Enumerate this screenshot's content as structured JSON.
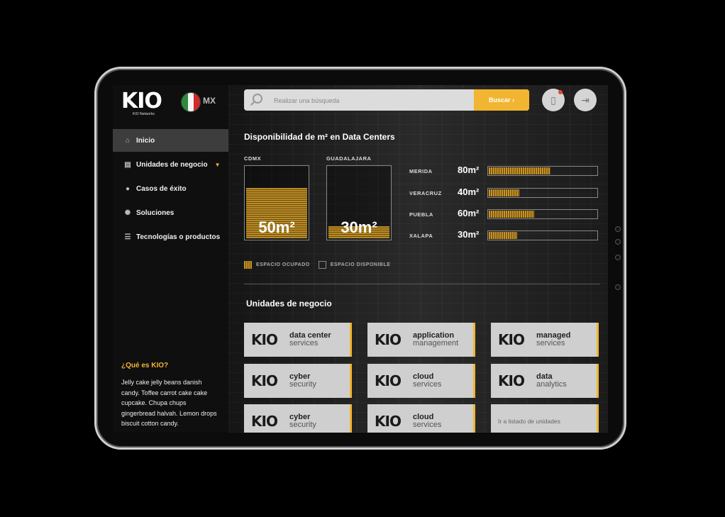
{
  "brand": {
    "logo": "KIO",
    "logo_sub": "KIO Networks",
    "country": "MX"
  },
  "colors": {
    "accent": "#f2b531",
    "sidebar_bg": "#0f0f0f",
    "card_bg": "#cfcfcf"
  },
  "sidebar": {
    "items": [
      {
        "label": "Inicio",
        "icon": "home-icon",
        "active": true
      },
      {
        "label": "Unidades de negocio",
        "icon": "server-icon",
        "has_dropdown": true
      },
      {
        "label": "Casos de éxito",
        "icon": "apple-icon"
      },
      {
        "label": "Soluciones",
        "icon": "lightbulb-icon"
      },
      {
        "label": "Tecnologías o productos",
        "icon": "list-icon"
      }
    ],
    "about_title": "¿Qué es KIO?",
    "about_text": "Jelly cake jelly beans danish candy. Toffee carrot cake cake cupcake. Chupa chups gingerbread halvah. Lemon drops biscuit cotton candy."
  },
  "search": {
    "placeholder": "Realizar una búsqueda",
    "button": "Buscar ›"
  },
  "availability": {
    "title": "Disponibilidad de m² en Data Centers",
    "main": [
      {
        "city": "CDMX",
        "value_label": "50m²",
        "occupied_fraction": 0.68
      },
      {
        "city": "GUADALAJARA",
        "value_label": "30m²",
        "occupied_fraction": 0.16
      }
    ],
    "rows": [
      {
        "city": "MERIDA",
        "value_label": "80m²",
        "occupied_fraction": 0.58
      },
      {
        "city": "VERACRUZ",
        "value_label": "40m²",
        "occupied_fraction": 0.29
      },
      {
        "city": "PUEBLA",
        "value_label": "60m²",
        "occupied_fraction": 0.43
      },
      {
        "city": "XALAPA",
        "value_label": "30m²",
        "occupied_fraction": 0.27
      }
    ],
    "legend_occupied": "ESPACIO OCUPADO",
    "legend_available": "ESPACIO DISPONIBLE"
  },
  "business_units": {
    "title": "Unidades de negocio",
    "cards": [
      {
        "line1": "data center",
        "line2": "services"
      },
      {
        "line1": "application",
        "line2": "management"
      },
      {
        "line1": "managed",
        "line2": "services"
      },
      {
        "line1": "cyber",
        "line2": "security"
      },
      {
        "line1": "cloud",
        "line2": "services"
      },
      {
        "line1": "data",
        "line2": "analytics"
      },
      {
        "line1": "cyber",
        "line2": "security"
      },
      {
        "line1": "cloud",
        "line2": "services"
      }
    ],
    "link_label": "Ir a listado de unidades"
  }
}
